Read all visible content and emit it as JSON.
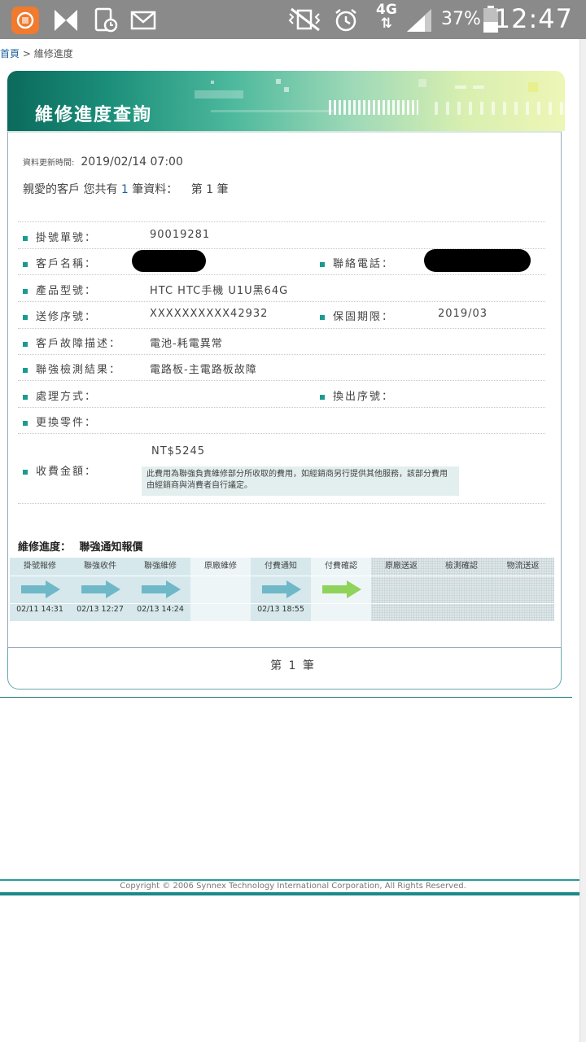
{
  "status_bar": {
    "time": "12:47",
    "battery_percent": "37%",
    "network": "4G",
    "icons": [
      "mi-app-icon",
      "hourglass-app-icon",
      "phone-clock-icon",
      "mail-icon",
      "vibrate-off-icon",
      "alarm-icon",
      "4g-signal-icon",
      "signal-bars-icon",
      "battery-icon"
    ]
  },
  "breadcrumb": {
    "home": "首頁",
    "separator": ">",
    "current": "維修進度"
  },
  "banner": {
    "title": "維修進度查詢"
  },
  "meta": {
    "update_label": "資料更新時間:",
    "update_value": "2019/02/14 07:00",
    "greeting_prefix": "親愛的客戶 您共有",
    "record_total": "1",
    "greeting_suffix": "筆資料：",
    "record_index_text": "第 1 筆"
  },
  "fields": {
    "ticket_no_label": "掛號單號：",
    "ticket_no_value": "90019281",
    "customer_name_label": "客戶名稱：",
    "contact_phone_label": "聯絡電話：",
    "model_label": "產品型號：",
    "model_value": "HTC HTC手機 U1U黑64G",
    "serial_label": "送修序號：",
    "serial_value": "XXXXXXXXXX42932",
    "warranty_label": "保固期限：",
    "warranty_value": "2019/03",
    "fault_label": "客戶故障描述：",
    "fault_value": "電池-耗電異常",
    "diag_label": "聯強檢測結果：",
    "diag_value": "電路板-主電路板故障",
    "process_label": "處理方式：",
    "swap_serial_label": "換出序號：",
    "parts_label": "更換零件：",
    "fee_label": "收費金額：",
    "fee_value": "NT$5245",
    "fee_note": "此費用為聯強負責維修部分所收取的費用，如經銷商另行提供其他服務，該部分費用由經銷商與消費者自行議定。"
  },
  "progress": {
    "title_label": "維修進度：",
    "title_value": "聯強通知報價",
    "steps": [
      {
        "label": "掛號報修",
        "date": "02/11 14:31",
        "state": "done"
      },
      {
        "label": "聯強收件",
        "date": "02/13 12:27",
        "state": "done"
      },
      {
        "label": "聯強維修",
        "date": "02/13 14:24",
        "state": "done"
      },
      {
        "label": "原廠維修",
        "date": "",
        "state": "skip"
      },
      {
        "label": "付費通知",
        "date": "02/13 18:55",
        "state": "done"
      },
      {
        "label": "付費確認",
        "date": "",
        "state": "current"
      },
      {
        "label": "原廠送返",
        "date": "",
        "state": "todo"
      },
      {
        "label": "檢測確認",
        "date": "",
        "state": "todo"
      },
      {
        "label": "物流送返",
        "date": "",
        "state": "todo"
      }
    ]
  },
  "colors": {
    "accent": "#1a9b90",
    "arrow_done": "#6fb8c8",
    "arrow_current": "#8fd35a",
    "banner_dark": "#0b6a5c"
  },
  "pagination": {
    "text": "第 1 筆"
  },
  "footer": {
    "copyright": "Copyright © 2006 Synnex Technology International Corporation, All Rights Reserved."
  }
}
